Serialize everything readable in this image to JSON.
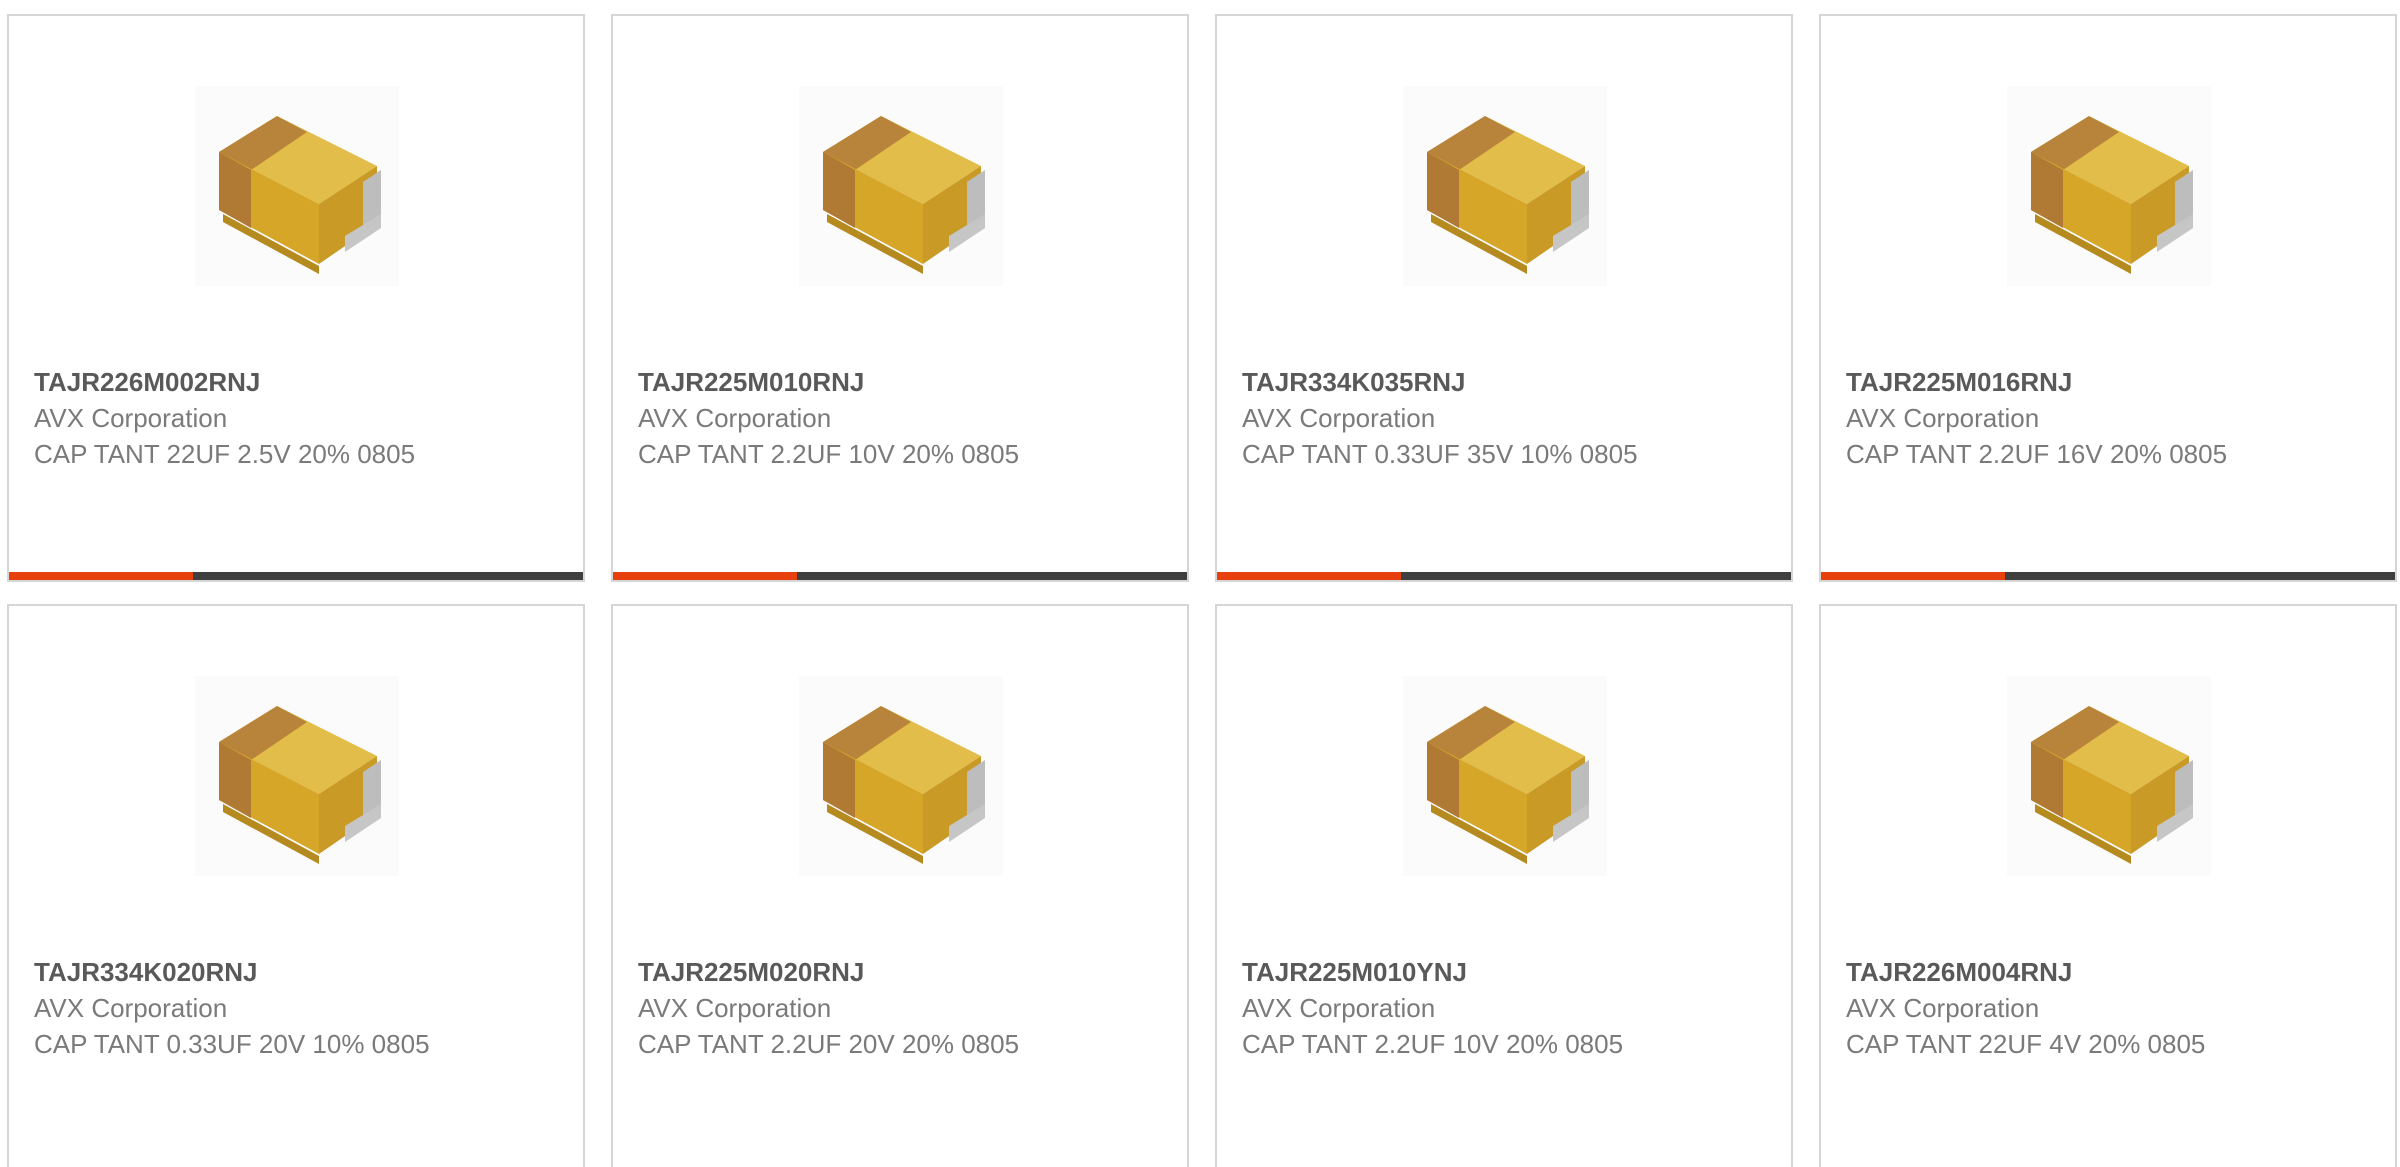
{
  "colors": {
    "accent": "#e8400c",
    "bar_track": "#3f3f3f",
    "card_border": "#d6d6d6",
    "part_text": "#595959",
    "secondary_text": "#7a7a7a",
    "capacitor_body": "#d6a629",
    "capacitor_band": "#b8833a",
    "terminal": "#b8b8b8"
  },
  "image": {
    "icon": "tantalum-capacitor-icon"
  },
  "products": [
    {
      "part_number": "TAJR226M002RNJ",
      "manufacturer": "AVX Corporation",
      "description": "CAP TANT 22UF 2.5V 20% 0805",
      "progress": 0.32
    },
    {
      "part_number": "TAJR225M010RNJ",
      "manufacturer": "AVX Corporation",
      "description": "CAP TANT 2.2UF 10V 20% 0805",
      "progress": 0.32
    },
    {
      "part_number": "TAJR334K035RNJ",
      "manufacturer": "AVX Corporation",
      "description": "CAP TANT 0.33UF 35V 10% 0805",
      "progress": 0.32
    },
    {
      "part_number": "TAJR225M016RNJ",
      "manufacturer": "AVX Corporation",
      "description": "CAP TANT 2.2UF 16V 20% 0805",
      "progress": 0.32
    },
    {
      "part_number": "TAJR334K020RNJ",
      "manufacturer": "AVX Corporation",
      "description": "CAP TANT 0.33UF 20V 10% 0805"
    },
    {
      "part_number": "TAJR225M020RNJ",
      "manufacturer": "AVX Corporation",
      "description": "CAP TANT 2.2UF 20V 20% 0805"
    },
    {
      "part_number": "TAJR225M010YNJ",
      "manufacturer": "AVX Corporation",
      "description": "CAP TANT 2.2UF 10V 20% 0805"
    },
    {
      "part_number": "TAJR226M004RNJ",
      "manufacturer": "AVX Corporation",
      "description": "CAP TANT 22UF 4V 20% 0805"
    }
  ]
}
